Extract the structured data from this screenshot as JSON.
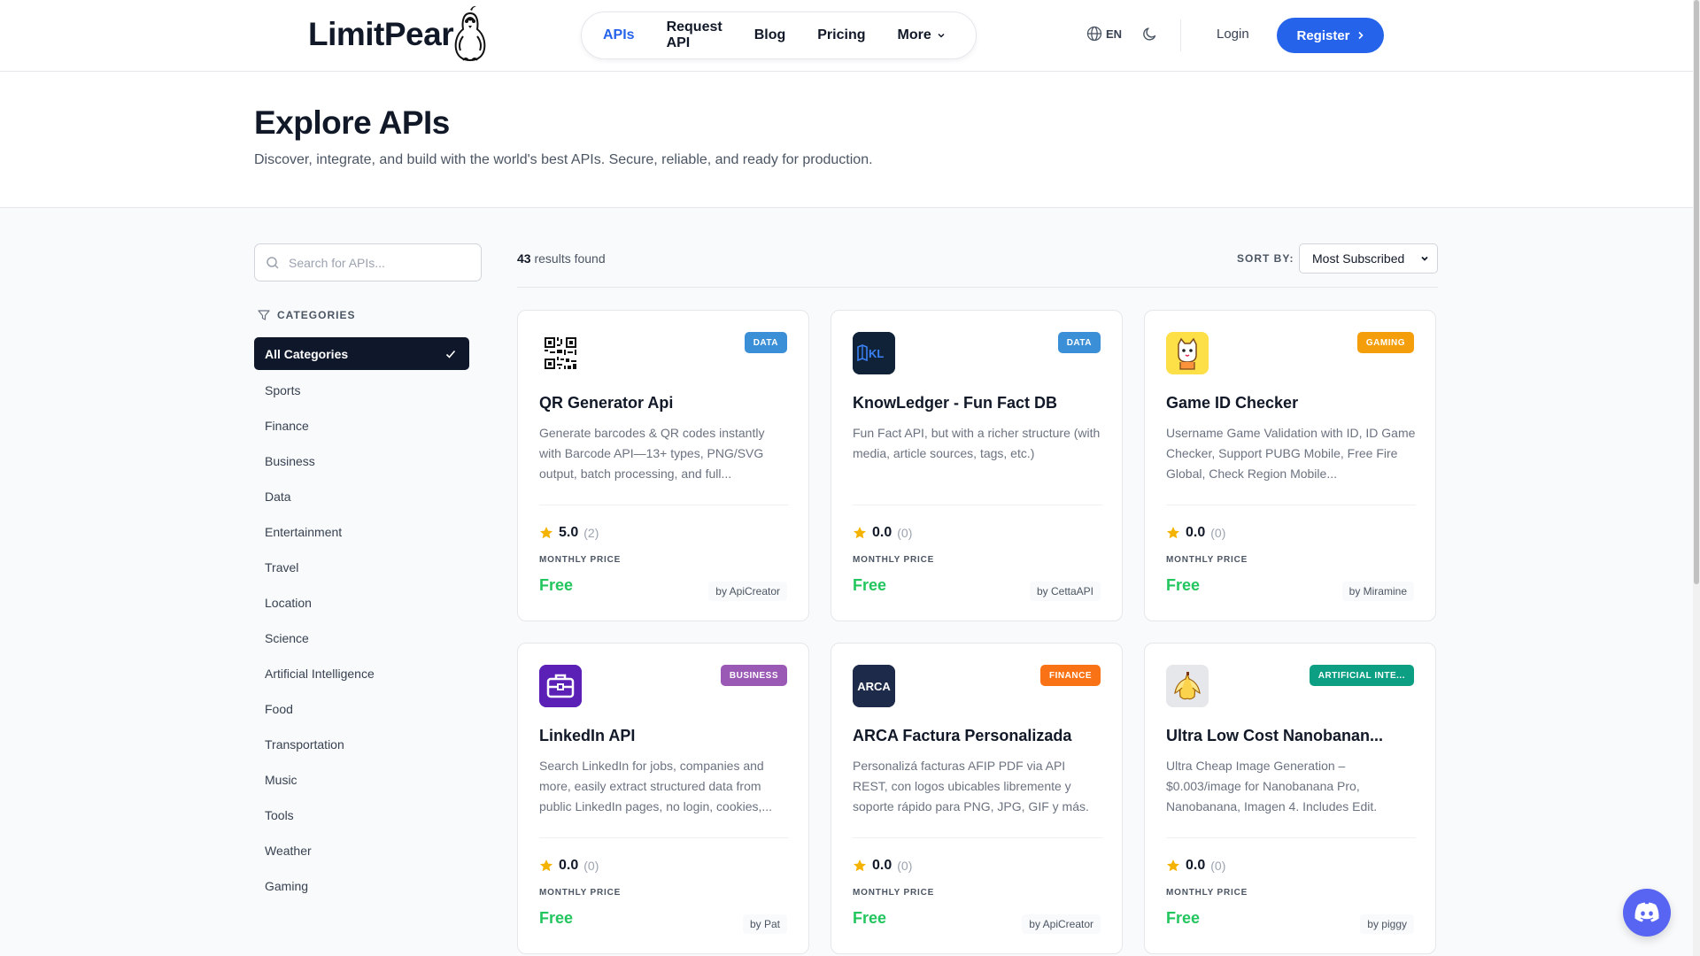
{
  "header": {
    "logo_text": "LimitPear",
    "nav": [
      {
        "label": "APIs",
        "active": true
      },
      {
        "label": "Request API"
      },
      {
        "label": "Blog"
      },
      {
        "label": "Pricing"
      },
      {
        "label": "More"
      }
    ],
    "language": "EN",
    "login": "Login",
    "register": "Register"
  },
  "hero": {
    "title": "Explore APIs",
    "subtitle": "Discover, integrate, and build with the world's best APIs. Secure, reliable, and ready for production."
  },
  "sidebar": {
    "search_placeholder": "Search for APIs...",
    "categories_title": "CATEGORIES",
    "categories": [
      "All Categories",
      "Sports",
      "Finance",
      "Business",
      "Data",
      "Entertainment",
      "Travel",
      "Location",
      "Science",
      "Artificial Intelligence",
      "Food",
      "Transportation",
      "Music",
      "Tools",
      "Weather",
      "Gaming"
    ]
  },
  "results": {
    "count": "43",
    "count_suffix": "results found",
    "sort_label": "SORT BY:",
    "sort_value": "Most Subscribed"
  },
  "cards": [
    {
      "title": "QR Generator Api",
      "badge": "DATA",
      "badge_color": "#3b8fd6",
      "logo": "qr-code-icon",
      "desc": "Generate barcodes & QR codes instantly with Barcode API—13+ types, PNG/SVG output, batch processing, and full...",
      "score": "5.0",
      "reviews": "(2)",
      "price_label": "MONTHLY PRICE",
      "price": "Free",
      "by": "by ApiCreator"
    },
    {
      "title": "KnowLedger - Fun Fact DB",
      "badge": "DATA",
      "badge_color": "#3b8fd6",
      "logo": "book-kl-icon",
      "logo_text": "KL",
      "desc": "Fun Fact API, but with a richer structure (with media, article sources, tags, etc.)",
      "score": "0.0",
      "reviews": "(0)",
      "price_label": "MONTHLY PRICE",
      "price": "Free",
      "by": "by CettaAPI"
    },
    {
      "title": "Game ID Checker",
      "badge": "GAMING",
      "badge_color": "#f59e0b",
      "logo": "cat-mascot-icon",
      "desc": "Username Game Validation with ID, ID Game Checker, Support PUBG Mobile, Free Fire Global, Check Region Mobile...",
      "score": "0.0",
      "reviews": "(0)",
      "price_label": "MONTHLY PRICE",
      "price": "Free",
      "by": "by Miramine"
    },
    {
      "title": "LinkedIn API",
      "badge": "BUSINESS",
      "badge_color": "#9b59b6",
      "logo": "briefcase-icon",
      "desc": "Search LinkedIn for jobs, companies and more, easily extract structured data from public LinkedIn pages, no login, cookies,...",
      "score": "0.0",
      "reviews": "(0)",
      "price_label": "MONTHLY PRICE",
      "price": "Free",
      "by": "by Pat"
    },
    {
      "title": "ARCA Factura Personalizada",
      "badge": "FINANCE",
      "badge_color": "#f97316",
      "logo": "arca-logo",
      "logo_text": "ARCA",
      "desc": "Personalizá facturas AFIP PDF via API REST, con logos ubicables libremente y soporte rápido para PNG, JPG, GIF y más.",
      "score": "0.0",
      "reviews": "(0)",
      "price_label": "MONTHLY PRICE",
      "price": "Free",
      "by": "by ApiCreator"
    },
    {
      "title": "Ultra Low Cost Nanobanan...",
      "badge": "ARTIFICIAL INTE...",
      "badge_color": "#0d9f83",
      "logo": "banana-icon",
      "desc": "Ultra Cheap Image Generation – $0.003/image for Nanobanana Pro, Nanobanana, Imagen 4. Includes Edit.",
      "score": "0.0",
      "reviews": "(0)",
      "price_label": "MONTHLY PRICE",
      "price": "Free",
      "by": "by piggy"
    }
  ]
}
